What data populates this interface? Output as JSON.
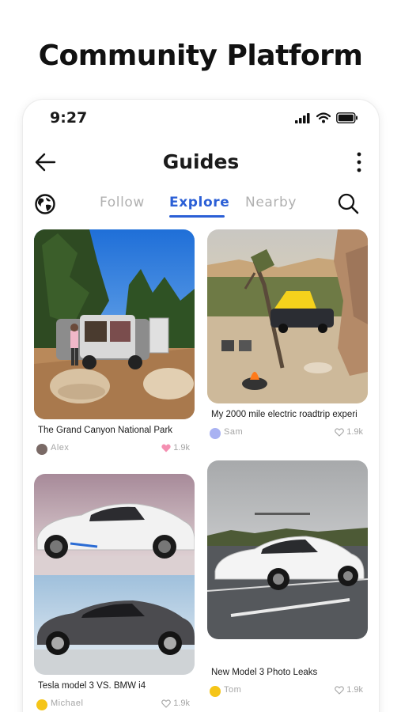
{
  "headline": "Community Platform",
  "status": {
    "time": "9:27"
  },
  "header": {
    "title": "Guides"
  },
  "tabs": [
    {
      "label": "Follow",
      "active": false
    },
    {
      "label": "Explore",
      "active": true
    },
    {
      "label": "Nearby",
      "active": false
    }
  ],
  "colors": {
    "accent": "#2b5fd6",
    "muted": "#b0b0b0",
    "liked_heart": "#f48fb1"
  },
  "posts": [
    {
      "title": "The Grand Canyon National Park",
      "author": "Alex",
      "likes": "1.9k",
      "avatar_color": "#7a6a66",
      "liked": true
    },
    {
      "title": "My 2000 mile electric roadtrip experi",
      "author": "Sam",
      "likes": "1.9k",
      "avatar_color": "#a9b2f2",
      "liked": false
    },
    {
      "title": "Tesla model 3 VS. BMW i4",
      "author": "Michael",
      "likes": "1.9k",
      "avatar_color": "#f5c518",
      "liked": false
    },
    {
      "title": "New Model 3 Photo Leaks",
      "author": "Tom",
      "likes": "1.9k",
      "avatar_color": "#f5c518",
      "liked": false
    }
  ]
}
